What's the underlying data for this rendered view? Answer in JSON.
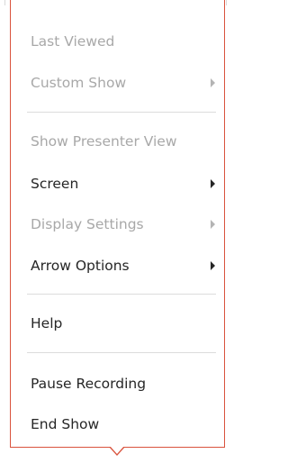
{
  "menu": {
    "items": [
      {
        "label": "Last Viewed",
        "enabled": false,
        "submenu": false
      },
      {
        "label": "Custom Show",
        "enabled": false,
        "submenu": true
      },
      {
        "label": "Show Presenter View",
        "enabled": false,
        "submenu": false
      },
      {
        "label": "Screen",
        "enabled": true,
        "submenu": true
      },
      {
        "label": "Display Settings",
        "enabled": false,
        "submenu": true
      },
      {
        "label": "Arrow Options",
        "enabled": true,
        "submenu": true
      },
      {
        "label": "Help",
        "enabled": true,
        "submenu": false
      },
      {
        "label": "Pause Recording",
        "enabled": true,
        "submenu": false
      },
      {
        "label": "End Show",
        "enabled": true,
        "submenu": false
      }
    ],
    "colors": {
      "border": "#d9533d",
      "text": "#262626",
      "disabled_text": "#a8a8a8",
      "separator": "#dcdcdc"
    },
    "icons": {
      "submenu": "chevron-right-icon"
    }
  }
}
